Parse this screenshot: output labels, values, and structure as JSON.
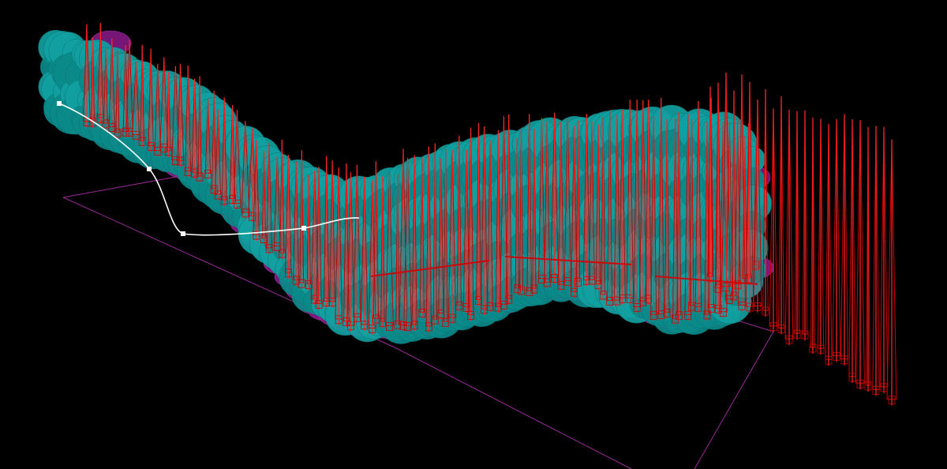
{
  "scene": {
    "background": "#000000",
    "colors": {
      "body": "#0a8a8a",
      "body_light": "#12a0a0",
      "underside": "#8b1a8b",
      "underside_mesh": "#b43cb4",
      "stems": "#d40000",
      "stems_light": "#ff2a2a",
      "boundary": "#9a2a9a",
      "path": "#ffffff"
    },
    "layers": [
      "mesh-body",
      "underside-mesh",
      "red-stem-cluster",
      "boundary-outline",
      "control-path"
    ],
    "icons": [
      "control-point-handle"
    ]
  }
}
